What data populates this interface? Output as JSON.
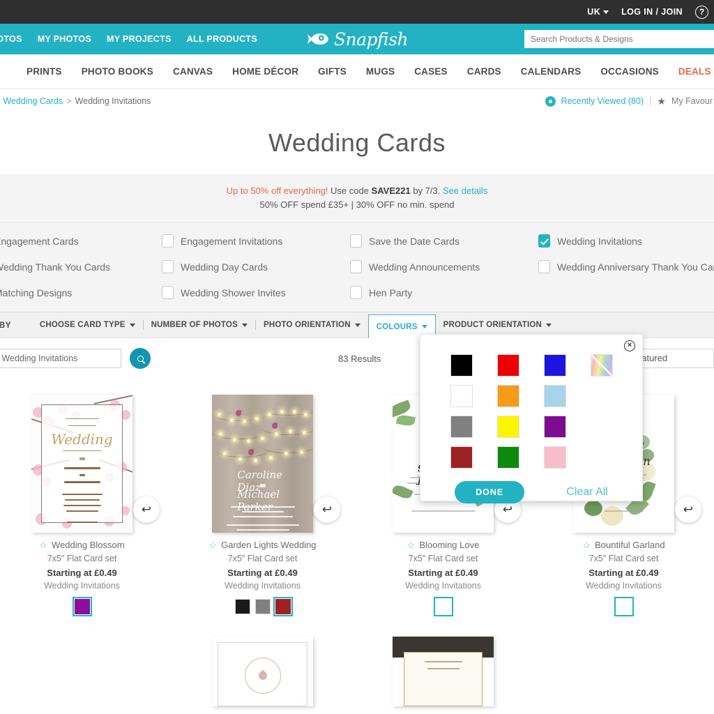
{
  "utility_bar": {
    "locale": "UK",
    "login": "LOG IN / JOIN",
    "help_icon": "?"
  },
  "brand_bar": {
    "nav": [
      {
        "label": "HOTOS"
      },
      {
        "label": "MY PHOTOS"
      },
      {
        "label": "MY PROJECTS"
      },
      {
        "label": "ALL PRODUCTS"
      }
    ],
    "logo_text": "Snapfish",
    "search_placeholder": "Search Products & Designs",
    "search_value": ""
  },
  "main_nav": [
    {
      "label": "PRINTS",
      "accent": false
    },
    {
      "label": "PHOTO BOOKS",
      "accent": false
    },
    {
      "label": "CANVAS",
      "accent": false
    },
    {
      "label": "HOME DÉCOR",
      "accent": false
    },
    {
      "label": "GIFTS",
      "accent": false
    },
    {
      "label": "MUGS",
      "accent": false
    },
    {
      "label": "CASES",
      "accent": false
    },
    {
      "label": "CARDS",
      "accent": false
    },
    {
      "label": "CALENDARS",
      "accent": false
    },
    {
      "label": "OCCASIONS",
      "accent": false
    },
    {
      "label": "DEALS",
      "accent": true
    }
  ],
  "breadcrumb": {
    "sep1": ">",
    "link1": "Wedding Cards",
    "sep2": ">",
    "current": "Wedding Invitations",
    "recently_viewed": "Recently Viewed (80)",
    "divider": "|",
    "favourites": "My Favour"
  },
  "page_title": "Wedding Cards",
  "promo": {
    "highlight": "Up to 50% off everything!",
    "use_code": "Use code",
    "code": "SAVE221",
    "by_date": "by 7/3.",
    "see_details": "See details",
    "line2": "50% OFF spend £35+ | 30% OFF no min. spend"
  },
  "categories": [
    {
      "label": "Engagement Cards",
      "checked": false,
      "has_box": false
    },
    {
      "label": "Engagement Invitations",
      "checked": false,
      "has_box": true
    },
    {
      "label": "Save the Date Cards",
      "checked": false,
      "has_box": true
    },
    {
      "label": "Wedding Invitations",
      "checked": true,
      "has_box": true
    },
    {
      "label": "Wedding Thank You Cards",
      "checked": false,
      "has_box": false
    },
    {
      "label": "Wedding Day Cards",
      "checked": false,
      "has_box": true
    },
    {
      "label": "Wedding Announcements",
      "checked": false,
      "has_box": true
    },
    {
      "label": "Wedding Anniversary Thank You Card",
      "checked": false,
      "has_box": true
    },
    {
      "label": "Matching Designs",
      "checked": false,
      "has_box": false
    },
    {
      "label": "Wedding Shower Invites",
      "checked": false,
      "has_box": true
    },
    {
      "label": "Hen Party",
      "checked": false,
      "has_box": true
    }
  ],
  "filter_bar": {
    "label": "R BY",
    "items": [
      {
        "label": "CHOOSE CARD TYPE",
        "active": false
      },
      {
        "label": "NUMBER OF PHOTOS",
        "active": false
      },
      {
        "label": "PHOTO ORIENTATION",
        "active": false
      },
      {
        "label": "COLOURS",
        "active": true
      },
      {
        "label": "PRODUCT ORIENTATION",
        "active": false
      }
    ]
  },
  "results": {
    "search_value": "n Wedding Invitations",
    "search_placeholder": "Search in Wedding Invitations",
    "count": "83 Results",
    "sort_value": "eatured"
  },
  "colour_panel": {
    "close_icon": "×",
    "swatches": [
      {
        "name": "black",
        "hex": "#000000"
      },
      {
        "name": "red",
        "hex": "#ec0000"
      },
      {
        "name": "blue",
        "hex": "#1a16e0"
      },
      {
        "name": "multicolour",
        "hex": "rainbow"
      },
      {
        "name": "white",
        "hex": "#ffffff"
      },
      {
        "name": "orange",
        "hex": "#f59b18"
      },
      {
        "name": "light-blue",
        "hex": "#a7d4e8"
      },
      {
        "name": "empty",
        "hex": "none"
      },
      {
        "name": "grey",
        "hex": "#808080"
      },
      {
        "name": "yellow",
        "hex": "#fcf500"
      },
      {
        "name": "purple",
        "hex": "#7c0d91"
      },
      {
        "name": "empty",
        "hex": "none"
      },
      {
        "name": "dark-red",
        "hex": "#9e2222"
      },
      {
        "name": "green",
        "hex": "#0b8a0b"
      },
      {
        "name": "pink",
        "hex": "#f7bdcb"
      },
      {
        "name": "empty",
        "hex": "none"
      }
    ],
    "done_label": "DONE",
    "clear_label": "Clear All"
  },
  "products": [
    {
      "title": "Wedding Blossom",
      "size": "7x5\" Flat Card set",
      "price": "Starting at £0.49",
      "category": "Wedding Invitations",
      "art": "blossom",
      "swatches": [
        {
          "hex": "#8d0d9c",
          "selected": true
        }
      ]
    },
    {
      "title": "Garden Lights Wedding",
      "size": "7x5\" Flat Card set",
      "price": "Starting at £0.49",
      "category": "Wedding Invitations",
      "art": "lights",
      "swatches": [
        {
          "hex": "#1a1a1a",
          "selected": false
        },
        {
          "hex": "#808080",
          "selected": false
        },
        {
          "hex": "#9e2222",
          "selected": true
        }
      ]
    },
    {
      "title": "Blooming Love",
      "size": "7x5\" Flat Card set",
      "price": "Starting at £0.49",
      "category": "Wedding Invitations",
      "art": "greenery",
      "swatches": [
        {
          "hex": "#ffffff",
          "selected": true
        }
      ]
    },
    {
      "title": "Bountiful Garland",
      "size": "7x5\" Flat Card set",
      "price": "Starting at £0.49",
      "category": "Wedding Invitations",
      "art": "garland",
      "swatches": [
        {
          "hex": "#ffffff",
          "selected": true
        }
      ]
    }
  ],
  "products_row2": [
    {
      "art": "none"
    },
    {
      "art": "seal"
    },
    {
      "art": "blackgold"
    },
    {
      "art": "none"
    }
  ],
  "icons": {
    "flip": "↩",
    "star": "☆",
    "caret": "▾"
  },
  "colors": {
    "brand_teal": "#23b2c4",
    "dark_bar": "#2f2f2f",
    "accent_orange": "#e8674e",
    "panel_grey": "#f4f4f4"
  }
}
